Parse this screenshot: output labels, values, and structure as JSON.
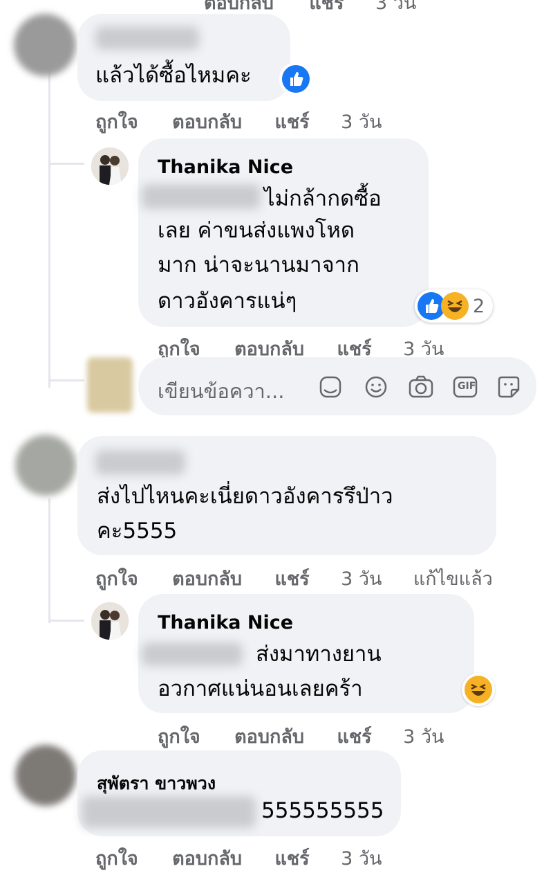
{
  "actions": {
    "like": "ถูกใจ",
    "reply": "ตอบกลับ",
    "share": "แชร์",
    "time": "3 วัน",
    "edited": "แก้ไขแล้ว"
  },
  "comments": [
    {
      "text_lines": [
        "แล้วได้ซื้อไหมคะ"
      ],
      "reactions": [
        "like"
      ]
    },
    {
      "author": "Thanika Nice",
      "text_lines": [
        "ไม่กล้ากดซื้อ",
        "เลย ค่าขนส่งแพงโหด",
        "มาก น่าจะนานมาจาก",
        "ดาวอังคารแน่ๆ"
      ],
      "reactions": [
        "like",
        "haha"
      ],
      "reaction_count": "2"
    },
    {
      "text_lines": [
        "ส่งไปไหนคะเนี่ยดาวอังคารรึป่าว",
        "คะ5555"
      ]
    },
    {
      "author": "Thanika Nice",
      "text_lines": [
        "ส่งมาทางยาน",
        "อวกาศแน่นอนเลยคร้า"
      ],
      "reactions": [
        "haha"
      ]
    },
    {
      "author": "สุพัตรา ขาวพวง",
      "text_lines": [
        "555555555"
      ]
    }
  ],
  "composer": {
    "placeholder": "เขียนข้อควา...",
    "icons": [
      "sticker-icon",
      "emoji-icon",
      "camera-icon",
      "gif-icon",
      "sticker-face-icon"
    ],
    "gif_label": "GIF"
  },
  "colors": {
    "bubble": "#f0f2f5",
    "action_text": "#65676b",
    "like_blue": "#1877f2",
    "haha_yellow": "#f7b125"
  }
}
